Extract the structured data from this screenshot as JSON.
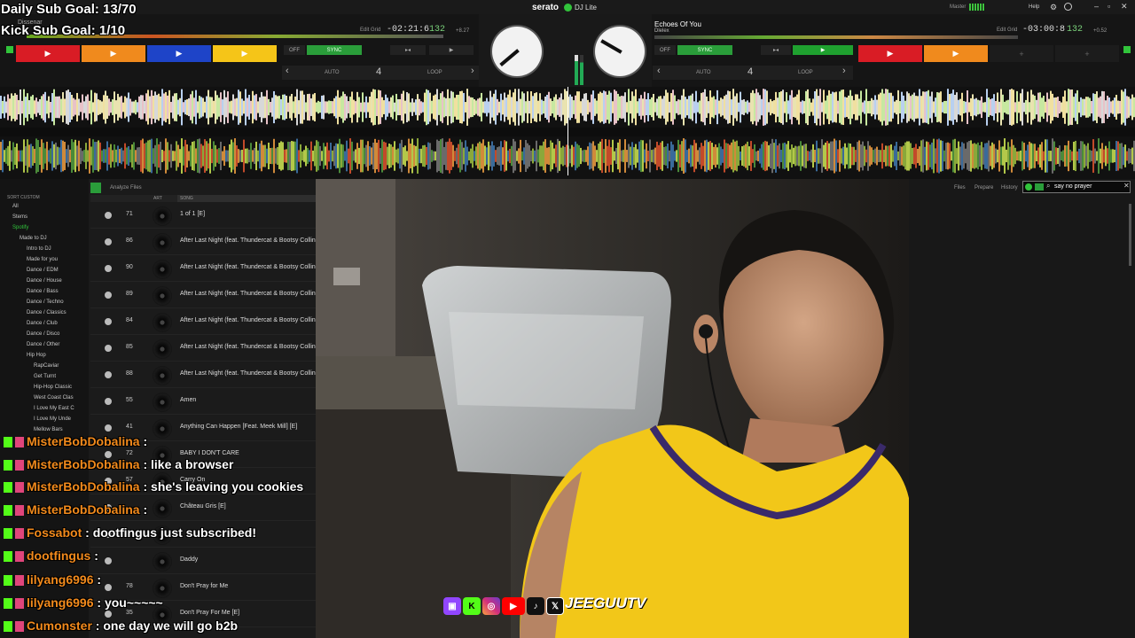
{
  "overlay": {
    "daily_goal": "Daily Sub Goal: 13/70",
    "kick_goal": "Kick Sub Goal: 1/10"
  },
  "app": {
    "brand": "serato",
    "product": "DJ Lite",
    "master_label": "Master",
    "help_label": "Help"
  },
  "deck_left": {
    "title": "Dissenar",
    "time": "-02:21:6",
    "bpm": "132",
    "pitch": "+8.27",
    "edit_grid": "Edit Grid",
    "sync": "SYNC",
    "off": "OFF",
    "auto": "AUTO",
    "loop": "LOOP",
    "loop_size": "4"
  },
  "deck_right": {
    "title": "Echoes Of You",
    "artist": "Dlelex",
    "time": "-03:00:8",
    "bpm": "132",
    "pitch": "+0.52",
    "edit_grid": "Edit Grid",
    "sync": "SYNC",
    "off": "OFF",
    "auto": "AUTO",
    "loop": "LOOP",
    "loop_size": "4"
  },
  "colors": {
    "pad_red": "#d91c25",
    "pad_orange": "#f08a1d",
    "pad_blue": "#1e44c8",
    "pad_yellow": "#f5c518",
    "sync_green": "#2a9d3a",
    "play_green": "#1fa12f",
    "chat_user": "#f28a1c",
    "accent_green": "#31c43b"
  },
  "library": {
    "analyze_label": "Analyze Files",
    "col_art": "ART",
    "col_song": "SONG",
    "sidebar_header": "SORT CUSTOM",
    "sidebar": [
      {
        "label": "All"
      },
      {
        "label": "Stems"
      },
      {
        "label": "Spotify"
      },
      {
        "label": "Made to DJ"
      },
      {
        "label": "Intro to DJ"
      },
      {
        "label": "Made for you"
      },
      {
        "label": "Dance / EDM"
      },
      {
        "label": "Dance / House"
      },
      {
        "label": "Dance / Bass"
      },
      {
        "label": "Dance / Techno"
      },
      {
        "label": "Dance / Classics"
      },
      {
        "label": "Dance / Club"
      },
      {
        "label": "Dance / Disco"
      },
      {
        "label": "Dance / Other"
      },
      {
        "label": "Hip Hop"
      },
      {
        "label": "RapCaviar"
      },
      {
        "label": "Get Turnt"
      },
      {
        "label": "Hip-Hop Classic"
      },
      {
        "label": "West Coast Clas"
      },
      {
        "label": "I Love My East C"
      },
      {
        "label": "I Love My Unde"
      },
      {
        "label": "Mellow Bars"
      }
    ],
    "tracks": [
      {
        "bpm": "71",
        "name": "1 of 1 [E]"
      },
      {
        "bpm": "86",
        "name": "After Last Night (feat. Thundercat & Bootsy Collins)"
      },
      {
        "bpm": "90",
        "name": "After Last Night (feat. Thundercat & Bootsy Collins)"
      },
      {
        "bpm": "89",
        "name": "After Last Night (feat. Thundercat & Bootsy Collins)"
      },
      {
        "bpm": "84",
        "name": "After Last Night (feat. Thundercat & Bootsy Collins)"
      },
      {
        "bpm": "85",
        "name": "After Last Night (feat. Thundercat & Bootsy Collins)"
      },
      {
        "bpm": "88",
        "name": "After Last Night (feat. Thundercat & Bootsy Collins)"
      },
      {
        "bpm": "55",
        "name": "Amen"
      },
      {
        "bpm": "41",
        "name": "Anything Can Happen [Feat. Meek Mill] [E]"
      },
      {
        "bpm": "72",
        "name": "BABY I DON'T CARE"
      },
      {
        "bpm": "57",
        "name": "Carry On"
      },
      {
        "bpm": "",
        "name": "Château Gris [E]"
      },
      {
        "bpm": "",
        "name": ""
      },
      {
        "bpm": "",
        "name": "Daddy"
      },
      {
        "bpm": "78",
        "name": "Don't Pray for Me"
      },
      {
        "bpm": "35",
        "name": "Don't Pray For Me [E]"
      }
    ]
  },
  "right_panel": {
    "files": "Files",
    "prepare": "Prepare",
    "history": "History",
    "search_value": "say no prayer"
  },
  "chat": [
    {
      "user": "MisterBobDobalina",
      "sep": " : ",
      "msg": ""
    },
    {
      "user": "MisterBobDobalina",
      "sep": " : ",
      "msg": "like a browser"
    },
    {
      "user": "MisterBobDobalina",
      "sep": " : ",
      "msg": "she's leaving you cookies"
    },
    {
      "user": "MisterBobDobalina",
      "sep": " : ",
      "msg": ""
    },
    {
      "user": "Fossabot",
      "sep": " : ",
      "msg": "dootfingus just subscribed!"
    },
    {
      "user": "dootfingus",
      "sep": " : ",
      "msg": ""
    },
    {
      "user": "lilyang6996",
      "sep": " : ",
      "msg": ""
    },
    {
      "user": "lilyang6996",
      "sep": " : ",
      "msg": "you~~~~~"
    },
    {
      "user": "Cumonster",
      "sep": " : ",
      "msg": "one day we will go b2b"
    }
  ],
  "socials": {
    "handle": "JEEGUUTV"
  }
}
